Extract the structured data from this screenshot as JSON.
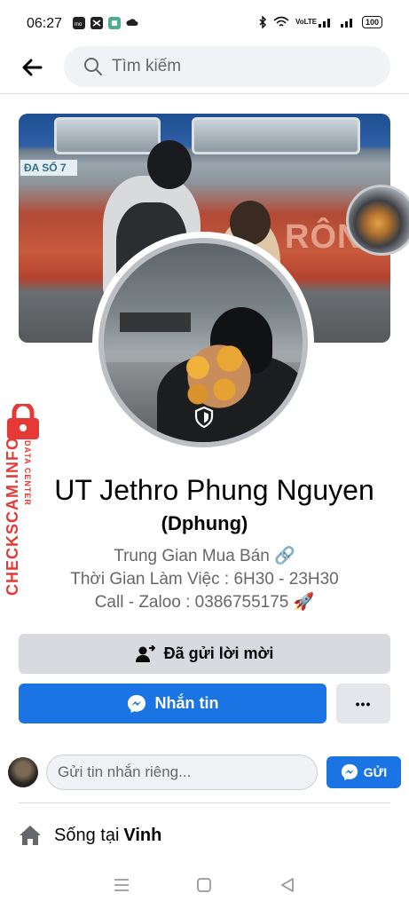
{
  "status_bar": {
    "time": "06:27",
    "app_icons": [
      "momo-icon",
      "capcut-icon",
      "zalo-icon",
      "cloud-icon"
    ],
    "network": "VoLTE",
    "battery": "100"
  },
  "header": {
    "search_placeholder": "Tìm kiếm"
  },
  "cover": {
    "sign_text": "ĐA SỐ 7",
    "train_text": "RÔNG"
  },
  "profile": {
    "name": "UT Jethro Phung Nguyen",
    "alternate_name": "(Dphung)",
    "bio": [
      "Trung Gian Mua Bán 🔗",
      "Thời Gian Làm Việc : 6H30 - 23H30",
      "Call - Zaloo : 0386755175 🚀"
    ]
  },
  "actions": {
    "request_sent_label": "Đã gửi lời mời",
    "message_label": "Nhắn tin",
    "more_label": "•••"
  },
  "private_message": {
    "placeholder": "Gửi tin nhắn riêng...",
    "send_label": "GỬI"
  },
  "about": {
    "lives_in_prefix": "Sống tại",
    "lives_in_city": "Vinh"
  },
  "watermark": {
    "main": "CHECKSCAM.INFO",
    "sub": "DATA CENTER"
  },
  "colors": {
    "brand_blue": "#1b74e4",
    "secondary_button": "#d8dadf",
    "watermark_red": "#e53935"
  }
}
